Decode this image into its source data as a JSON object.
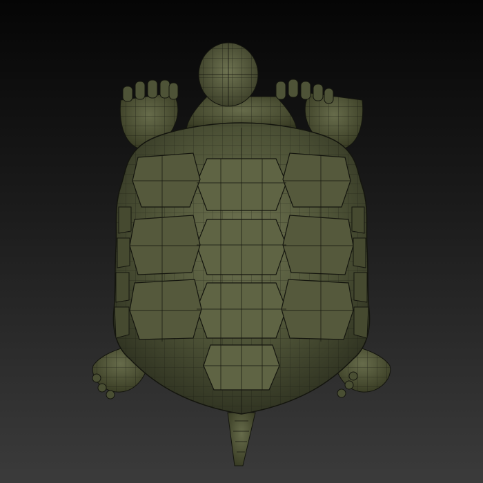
{
  "scene": {
    "subject": "turtle",
    "view": "top-down",
    "render_style": "wireframe-on-shaded",
    "colors": {
      "background_top": "#050505",
      "background_bottom": "#3b3b3b",
      "shell_fill": "#4d5236",
      "shell_light": "#6d7250",
      "shell_dark": "#2a2d1d",
      "wire": "#14150e"
    }
  }
}
